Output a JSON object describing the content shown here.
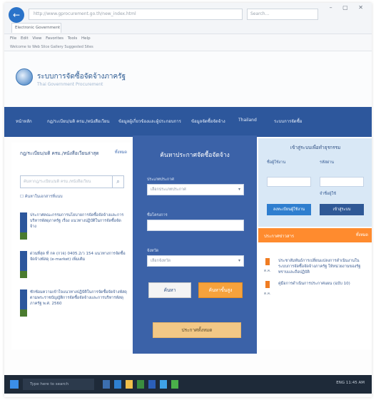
{
  "browser": {
    "url": "http://www.gprocurement.go.th/new_index.html",
    "search": "Search...",
    "tab_label": "Electronic Government Pro...",
    "menu": "File  Edit  View  Favorites  Tools  Help",
    "favorites": "Welcome to Web Slice Gallery   Suggested Sites"
  },
  "site": {
    "title": "ระบบการจัดซื้อจัดจ้างภาครัฐ",
    "subtitle": "Thai Government Procurement"
  },
  "nav": {
    "items": [
      "หน้าหลัก",
      "กฎ/ระเบียบ/มติ ครม./หนังสือเวียน",
      "ข้อมูลผู้เกี่ยวข้องและผู้ประกอบการ",
      "ข้อมูลจัดซื้อจัดจ้าง",
      "Thailand",
      "ระบบการจัดซื้อ"
    ]
  },
  "left_panel": {
    "title": "กฎ/ระเบียบ/มติ ครม./หนังสือเวียนล่าสุด",
    "more": "ทั้งหมด",
    "search_placeholder": "ค้นหากฎ/ระเบียบ/มติ ครม./หนังสือเวียน",
    "check_label": "ค้นหาในเอกสารที่แนบ",
    "news": [
      "ประกาศคณะกรรมการนโยบายการจัดซื้อจัดจ้างและการบริหารพัสดุภาครัฐ เรื่อง แนวทางปฏิบัติในการจัดซื้อจัดจ้าง",
      "ด่วนที่สุด ที่ กค (กวจ) 0405.2/ว 154 แนวทางการจัดซื้อจัดจ้างพัสดุ (e-market) เพิ่มเติม",
      "ซักซ้อมความเข้าใจแนวทางปฏิบัติในการจัดซื้อจัดจ้างพัสดุตามพระราชบัญญัติการจัดซื้อจัดจ้างและการบริหารพัสดุภาครัฐ พ.ศ. 2560"
    ]
  },
  "mid_panel": {
    "title": "ค้นหาประกาศจัดซื้อจัดจ้าง",
    "field1_label": "ประเภทประกาศ",
    "field1_value": "เลือกประเภทประกาศ",
    "field2_label": "ชื่อโครงการ",
    "field2_value": "",
    "field3_label": "จังหวัด",
    "field3_value": "เลือกจังหวัด",
    "search_btn": "ค้นหา",
    "adv_btn": "ค้นหาขั้นสูง",
    "bottom_btn": "ประกาศทั้งหมด"
  },
  "right_panel": {
    "login_title": "เข้าสู่ระบบเพื่อทำธุรกรรม",
    "user_label": "ชื่อผู้ใช้งาน",
    "pass_label": "รหัสผ่าน",
    "remember": "จำชื่อผู้ใช้",
    "register_btn": "ลงทะเบียนผู้ใช้งาน",
    "login_btn": "เข้าสู่ระบบ",
    "notice_title": "ประกาศข่าวสาร",
    "notice_more": "ทั้งหมด",
    "notices": [
      {
        "date": "ต.ค.",
        "text": "ประชาสัมพันธ์การเปลี่ยนแปลงการดำเนินงานในระบบการจัดซื้อจัดจ้างภาครัฐ ให้หน่วยงานของรัฐทราบและถือปฏิบัติ"
      },
      {
        "date": "ต.ค.",
        "text": "คู่มือการดำเนินการประกาศแผน (ฉบับ 10)"
      }
    ]
  },
  "taskbar": {
    "search": "Type here to search",
    "clock": "ENG 11:45 AM"
  }
}
